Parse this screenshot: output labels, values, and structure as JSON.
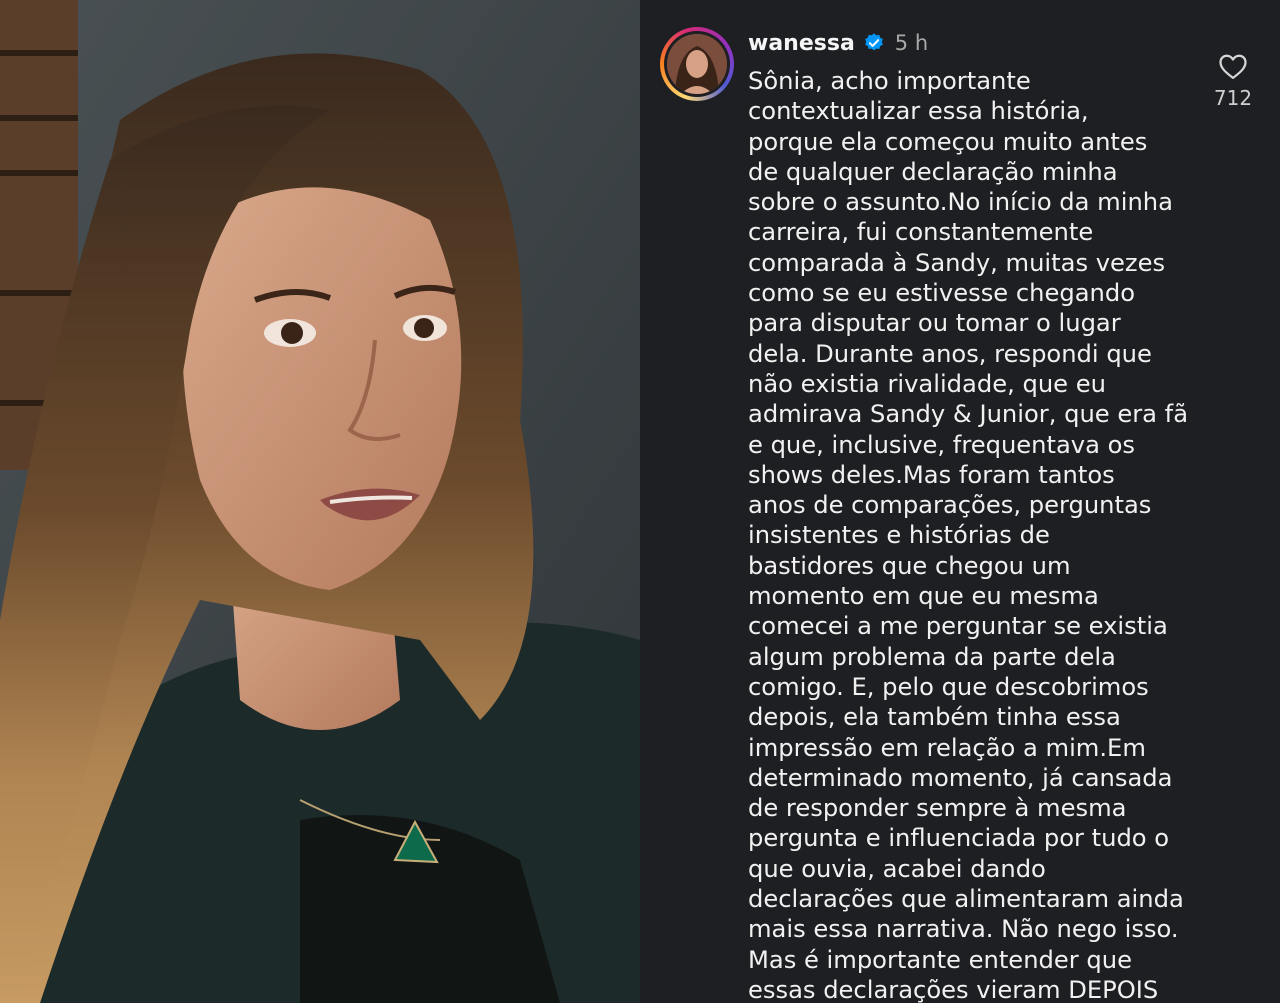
{
  "post": {
    "username": "wanessa",
    "time": "5 h",
    "like_count": "712",
    "icons": {
      "verified": "verified-badge-icon",
      "like": "heart-outline-icon"
    },
    "colors": {
      "background": "#1e1f22",
      "text": "#f1f1f1",
      "muted": "#a8a8a8",
      "verified": "#0095f6"
    },
    "comment_lines": [
      "Sônia, acho importante",
      "contextualizar essa história,",
      "porque ela começou muito antes",
      "de qualquer declaração minha",
      "sobre o assunto.No início da minha",
      "carreira, fui constantemente",
      "comparada à Sandy, muitas vezes",
      "como se eu estivesse chegando",
      "para disputar ou tomar o lugar",
      "dela. Durante anos, respondi que",
      "não existia rivalidade, que eu",
      "admirava Sandy & Junior, que era fã",
      "e que, inclusive, frequentava os",
      "shows deles.Mas foram tantos",
      "anos de comparações, perguntas",
      "insistentes e histórias de",
      "bastidores que chegou um",
      "momento em que eu mesma",
      "comecei a me perguntar se existia",
      "algum problema da parte dela",
      "comigo. E, pelo que descobrimos",
      "depois, ela também tinha essa",
      "impressão em relação a mim.Em",
      "determinado momento, já cansada",
      "de responder sempre à mesma",
      "pergunta e influenciada por tudo o",
      "que ouvia, acabei dando",
      "declarações que alimentaram ainda",
      "mais essa narrativa. Não nego isso.",
      "Mas é importante entender que",
      "essas declarações vieram DEPOIS"
    ]
  }
}
